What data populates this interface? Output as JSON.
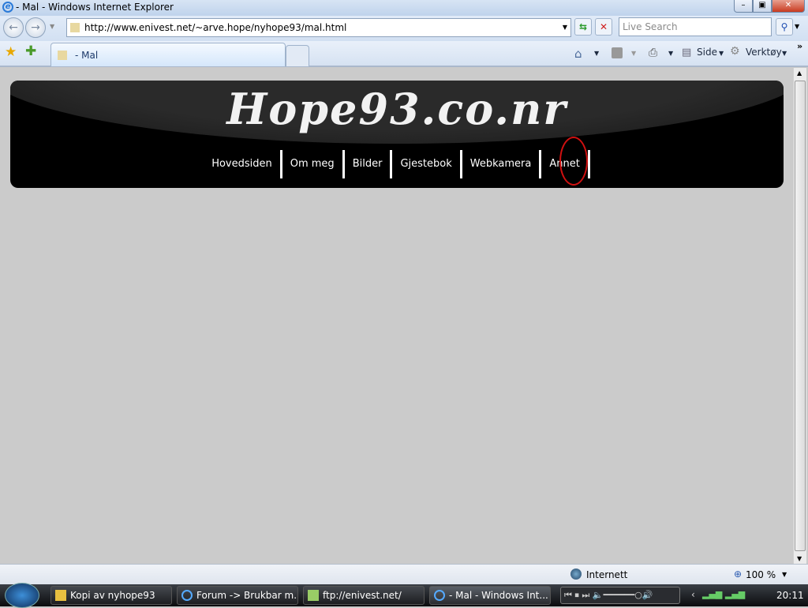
{
  "window": {
    "title": "- Mal - Windows Internet Explorer"
  },
  "address": {
    "url": "http://www.enivest.net/~arve.hope/nyhope93/mal.html"
  },
  "search": {
    "placeholder": "Live Search"
  },
  "tabs": [
    {
      "label": "- Mal"
    }
  ],
  "command_bar": {
    "page": "Side",
    "tools": "Verktøy"
  },
  "page": {
    "logo": "Hope93.co.nr",
    "menu": [
      "Hovedsiden",
      "Om meg",
      "Bilder",
      "Gjestebok",
      "Webkamera",
      "Annet"
    ]
  },
  "status": {
    "zone": "Internett",
    "zoom": "100 %"
  },
  "taskbar": {
    "items": [
      "Kopi av nyhope93",
      "Forum -> Brukbar m...",
      "ftp://enivest.net/",
      "- Mal - Windows Int..."
    ],
    "clock": "20:11"
  }
}
